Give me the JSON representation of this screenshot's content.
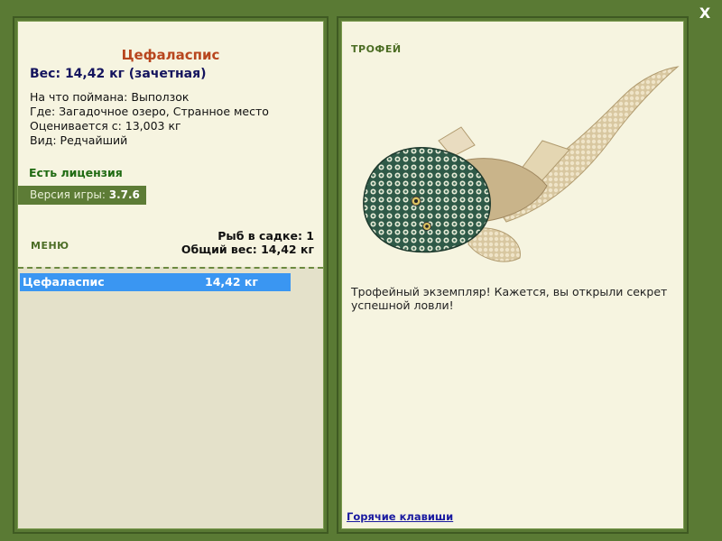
{
  "window": {
    "close_label": "X"
  },
  "fish": {
    "name": "Цефаласпис",
    "weight_line": "Вес: 14,42 кг (зачетная)",
    "caught_on": "На что поймана: Выползок",
    "location": "Где: Загадочное озеро, Странное место",
    "valued_from": "Оценивается с: 13,003 кг",
    "kind": "Вид: Редчайший"
  },
  "license": "Есть лицензия",
  "version": {
    "label": "Версия игры:",
    "value": "3.7.6"
  },
  "menu_label": "МЕНЮ",
  "cage": {
    "count_line": "Рыб в садке: 1",
    "total_line": "Общий вес: 14,42 кг",
    "items": [
      {
        "name": "Цефаласпис",
        "weight": "14,42 кг"
      }
    ]
  },
  "trophy": {
    "label": "ТРОФЕЙ",
    "text": "Трофейный экземпляр! Кажется, вы открыли секрет успешной ловли!"
  },
  "hotkeys_link": "Горячие клавиши",
  "colors": {
    "background": "#5a7a34",
    "title": "#b8461e",
    "weight": "#14145e",
    "license": "#1f6a12",
    "selected_row": "#3a96f2",
    "link": "#1a1aa0"
  }
}
